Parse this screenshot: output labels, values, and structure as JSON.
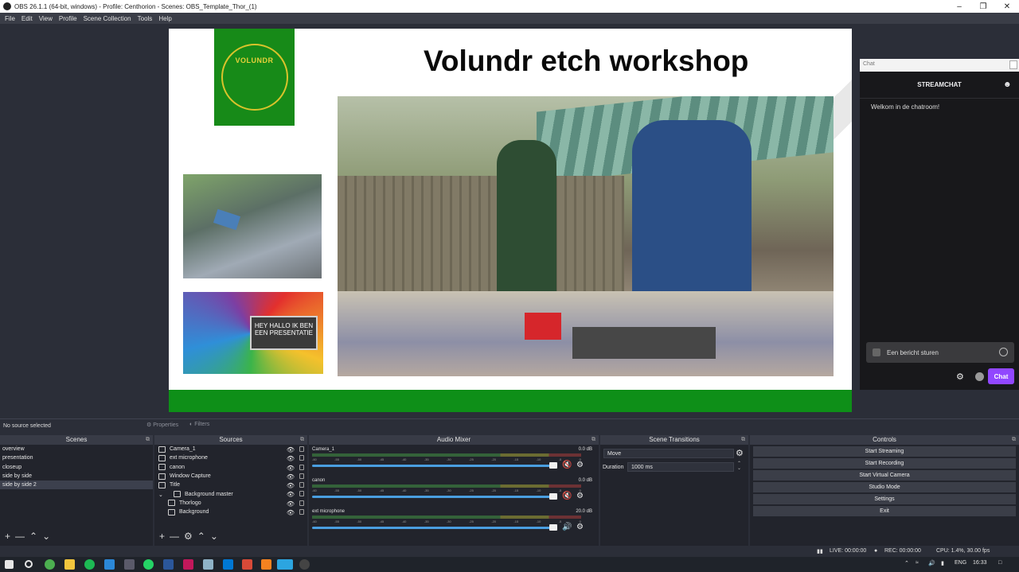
{
  "window": {
    "title": "OBS 26.1.1 (64-bit, windows) - Profile: Centhorion - Scenes: OBS_Template_Thor_(1)",
    "minimize": "–",
    "maximize": "❐",
    "close": "✕"
  },
  "menu": [
    "File",
    "Edit",
    "View",
    "Profile",
    "Scene Collection",
    "Tools",
    "Help"
  ],
  "preview": {
    "heading": "Volundr etch workshop",
    "logo_text": "VOLUNDR",
    "slide_card_text": "HEY HALLO IK BEN EEN PRESENTATIE",
    "colors": {
      "green_bar": "#0e8f18",
      "logo_bg": "#178a18"
    }
  },
  "chat": {
    "dock_title": "Chat",
    "header": "STREAMCHAT",
    "welcome": "Welkom in de chatroom!",
    "input_placeholder": "Een bericht sturen",
    "send_label": "Chat",
    "accent": "#9147ff"
  },
  "source_toolbar": {
    "status": "No source selected",
    "properties": "Properties",
    "filters": "Filters"
  },
  "scenes": {
    "title": "Scenes",
    "items": [
      "overview",
      "presentation",
      "closeup",
      "side by side",
      "side by side 2"
    ],
    "selected": "side by side 2"
  },
  "sources": {
    "title": "Sources",
    "items": [
      {
        "label": "Camera_1",
        "icon": "camera-icon"
      },
      {
        "label": "ext microphone",
        "icon": "microphone-icon"
      },
      {
        "label": "canon",
        "icon": "camera-icon"
      },
      {
        "label": "Window Capture",
        "icon": "window-icon"
      },
      {
        "label": "Title",
        "icon": "text-icon"
      },
      {
        "label": "Background master",
        "icon": "group-icon"
      },
      {
        "label": "Thorlogo",
        "icon": "image-icon"
      },
      {
        "label": "Background",
        "icon": "image-icon"
      }
    ]
  },
  "mixer": {
    "title": "Audio Mixer",
    "ticks": [
      "-60",
      "-55",
      "-50",
      "-45",
      "-40",
      "-35",
      "-30",
      "-25",
      "-20",
      "-15",
      "-10",
      "-5",
      "0"
    ],
    "channels": [
      {
        "name": "Camera_1",
        "db": "0.0 dB",
        "muted": true
      },
      {
        "name": "canon",
        "db": "0.0 dB",
        "muted": true
      },
      {
        "name": "ext microphone",
        "db": "20.0 dB",
        "muted": false
      }
    ]
  },
  "transitions": {
    "title": "Scene Transitions",
    "selected": "Move",
    "duration_label": "Duration",
    "duration_value": "1000 ms"
  },
  "controls": {
    "title": "Controls",
    "buttons": [
      "Start Streaming",
      "Start Recording",
      "Start Virtual Camera",
      "Studio Mode",
      "Settings",
      "Exit"
    ]
  },
  "status": {
    "live": "LIVE: 00:00:00",
    "rec": "REC: 00:00:00",
    "cpu": "CPU: 1.4%, 30.00 fps"
  },
  "taskbar": {
    "lang": "ENG",
    "time": "16:33"
  }
}
